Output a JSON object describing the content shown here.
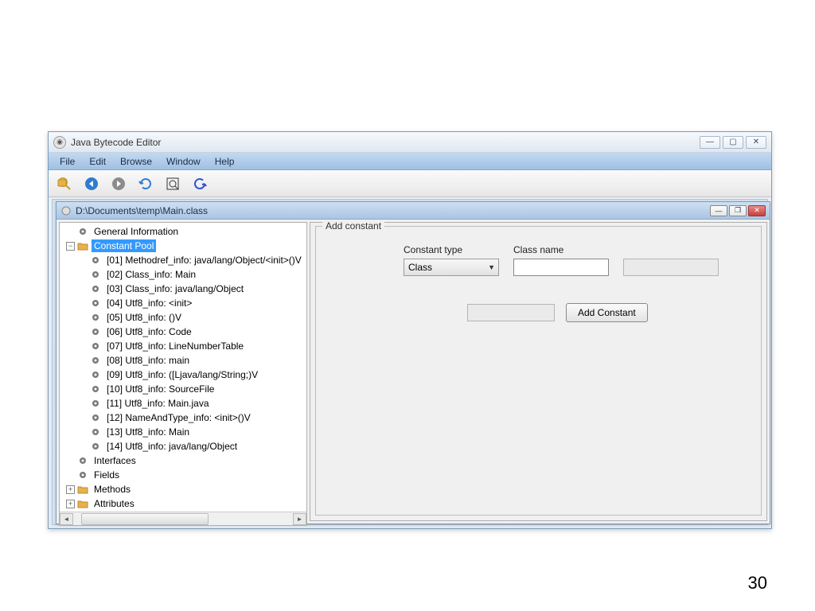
{
  "app": {
    "title": "Java Bytecode Editor",
    "window_controls": {
      "minimize": "—",
      "maximize": "▢",
      "close": "✕"
    }
  },
  "menu": {
    "items": [
      "File",
      "Edit",
      "Browse",
      "Window",
      "Help"
    ]
  },
  "toolbar": {
    "buttons": [
      {
        "name": "open-icon"
      },
      {
        "name": "back-icon"
      },
      {
        "name": "forward-icon"
      },
      {
        "name": "refresh-icon"
      },
      {
        "name": "inspect-icon"
      },
      {
        "name": "reload-icon"
      }
    ]
  },
  "document": {
    "title": "D:\\Documents\\temp\\Main.class",
    "controls": {
      "minimize": "—",
      "restore": "❐",
      "close": "✕"
    }
  },
  "tree": {
    "nodes": [
      {
        "depth": 0,
        "icon": "gear",
        "exp": "hidden",
        "label": "General Information"
      },
      {
        "depth": 0,
        "icon": "folder",
        "exp": "minus",
        "label": "Constant Pool",
        "selected": true
      },
      {
        "depth": 1,
        "icon": "gear",
        "exp": "hidden",
        "label": "[01] Methodref_info: java/lang/Object/<init>()V"
      },
      {
        "depth": 1,
        "icon": "gear",
        "exp": "hidden",
        "label": "[02] Class_info: Main"
      },
      {
        "depth": 1,
        "icon": "gear",
        "exp": "hidden",
        "label": "[03] Class_info: java/lang/Object"
      },
      {
        "depth": 1,
        "icon": "gear",
        "exp": "hidden",
        "label": "[04] Utf8_info: <init>"
      },
      {
        "depth": 1,
        "icon": "gear",
        "exp": "hidden",
        "label": "[05] Utf8_info: ()V"
      },
      {
        "depth": 1,
        "icon": "gear",
        "exp": "hidden",
        "label": "[06] Utf8_info: Code"
      },
      {
        "depth": 1,
        "icon": "gear",
        "exp": "hidden",
        "label": "[07] Utf8_info: LineNumberTable"
      },
      {
        "depth": 1,
        "icon": "gear",
        "exp": "hidden",
        "label": "[08] Utf8_info: main"
      },
      {
        "depth": 1,
        "icon": "gear",
        "exp": "hidden",
        "label": "[09] Utf8_info: ([Ljava/lang/String;)V"
      },
      {
        "depth": 1,
        "icon": "gear",
        "exp": "hidden",
        "label": "[10] Utf8_info: SourceFile"
      },
      {
        "depth": 1,
        "icon": "gear",
        "exp": "hidden",
        "label": "[11] Utf8_info: Main.java"
      },
      {
        "depth": 1,
        "icon": "gear",
        "exp": "hidden",
        "label": "[12] NameAndType_info: <init>()V"
      },
      {
        "depth": 1,
        "icon": "gear",
        "exp": "hidden",
        "label": "[13] Utf8_info: Main"
      },
      {
        "depth": 1,
        "icon": "gear",
        "exp": "hidden",
        "label": "[14] Utf8_info: java/lang/Object"
      },
      {
        "depth": 0,
        "icon": "gear",
        "exp": "hidden",
        "label": "Interfaces"
      },
      {
        "depth": 0,
        "icon": "gear",
        "exp": "hidden",
        "label": "Fields"
      },
      {
        "depth": 0,
        "icon": "folder",
        "exp": "plus",
        "label": "Methods"
      },
      {
        "depth": 0,
        "icon": "folder",
        "exp": "plus",
        "label": "Attributes"
      }
    ]
  },
  "panel": {
    "group_title": "Add constant",
    "labels": {
      "constant_type": "Constant type",
      "class_name": "Class name"
    },
    "constant_type_value": "Class",
    "class_name_value": "",
    "add_button": "Add Constant"
  },
  "page_number": "30"
}
